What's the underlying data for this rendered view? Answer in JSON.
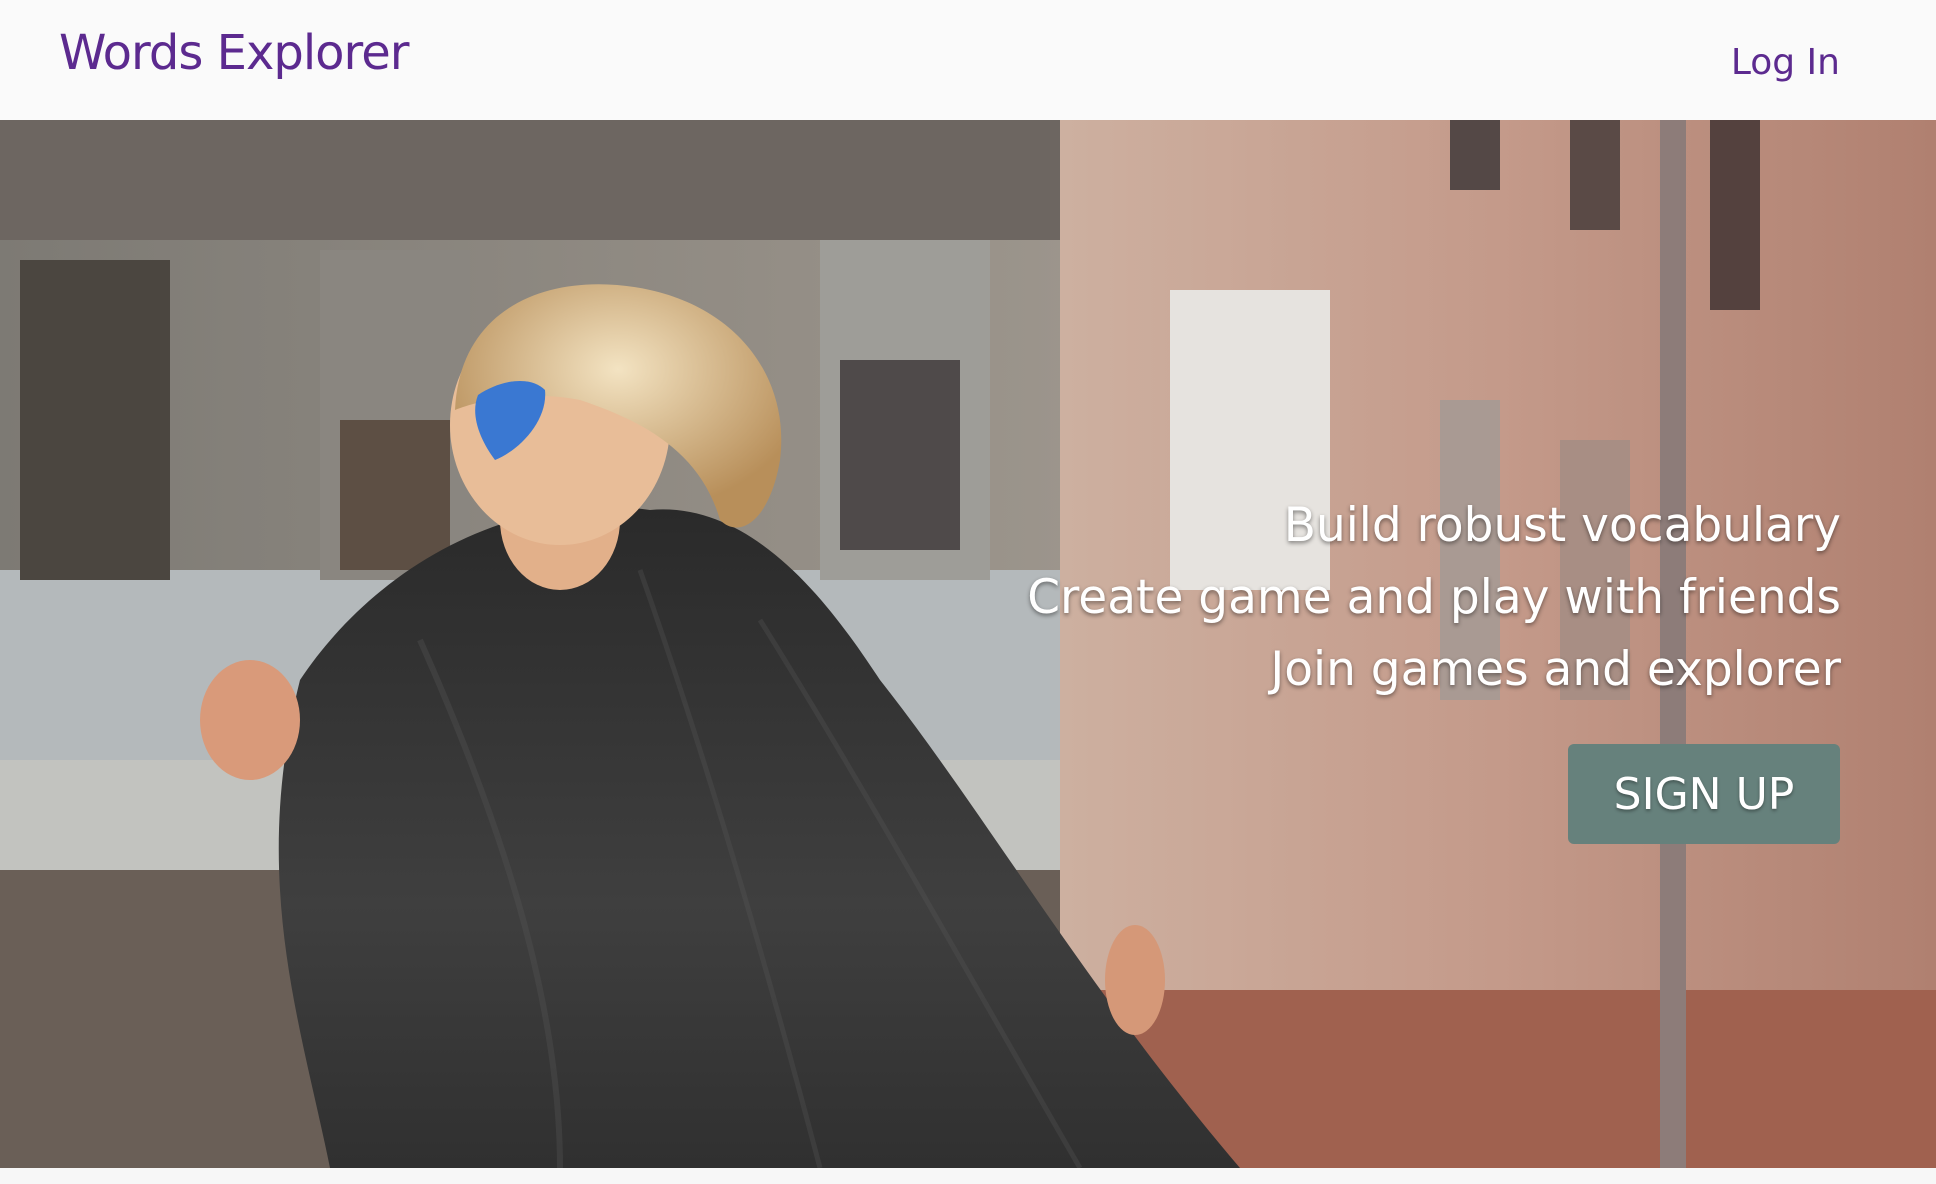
{
  "header": {
    "brand": "Words Explorer",
    "login_label": "Log In"
  },
  "hero": {
    "image_alt": "Child wearing a blue mask and dark cape in front of a brick building",
    "taglines": [
      "Build robust vocabulary",
      "Create game and play with friends",
      "Join games and explorer"
    ],
    "signup_label": "SIGN UP"
  },
  "colors": {
    "brand": "#5c2a8f",
    "signup_button": "#66817c",
    "navbar_bg": "#fafafa"
  }
}
